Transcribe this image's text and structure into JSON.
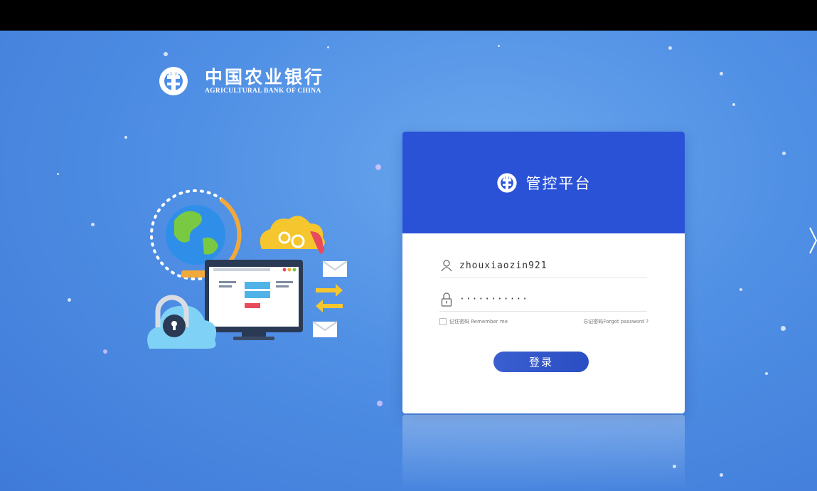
{
  "bank": {
    "name_cn": "中国农业银行",
    "name_en": "AGRICULTURAL BANK OF CHINA"
  },
  "card": {
    "title": "管控平台",
    "username_value": "zhouxiaozin921",
    "password_value": "···········",
    "remember_label": "记住密码 Remember me",
    "forgot_label": "忘记密码Forgot password ?",
    "login_label": "登录"
  },
  "icons": {
    "bank_logo": "abc-logo-icon",
    "user": "user-icon",
    "lock": "lock-icon",
    "next": "chevron-right-icon"
  },
  "colors": {
    "background": "#4f8fe4",
    "card_header": "#2a52d7",
    "button": "#2f54c8"
  }
}
